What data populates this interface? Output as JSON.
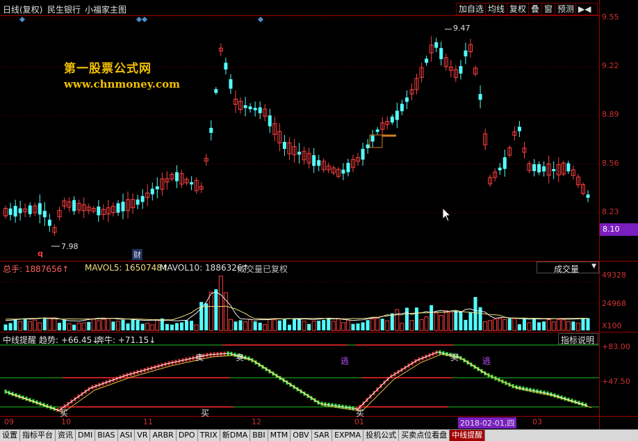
{
  "title_bar": {
    "mode": "日线(复权)",
    "stock": "民生银行",
    "template": "小福家主图",
    "buttons": [
      "加自选",
      "均线",
      "复权",
      "叠",
      "窗",
      "预测"
    ],
    "right_glyph": "▶◀"
  },
  "watermark": {
    "line1": "第一股票公式网",
    "line2": "www.chnmoney.com"
  },
  "price_axis": {
    "ticks": [
      "9.55",
      "9.22",
      "8.89",
      "8.56",
      "8.23"
    ],
    "current": "8.10"
  },
  "price_annotations": {
    "high": "9.47",
    "low": "7.98",
    "marker_q": "q",
    "marker_cai": "财"
  },
  "volume_pane": {
    "label_total": "总手: 1887656↑",
    "label_mavol5": "MAVOL5: 1650748↑",
    "label_mavol10": "MAVOL10: 1886326↑",
    "label_note": "成交量已复权",
    "selector": "成交量",
    "axis_ticks": [
      "49328",
      "24968"
    ],
    "axis_unit": "X100"
  },
  "indicator_pane": {
    "name": "中线提醒",
    "trend": "趋势: +66.45↓",
    "bull": "奔牛: +71.15↓",
    "help_button": "指标说明",
    "axis_ticks": [
      "+83.00",
      "+47.50"
    ],
    "signals_sell": [
      "卖",
      "卖"
    ],
    "signal_escape": [
      "逃",
      "逃"
    ],
    "signals_buy": [
      "买",
      "买",
      "买",
      "买"
    ]
  },
  "time_axis": {
    "labels": [
      "09",
      "10",
      "11",
      "12",
      "01",
      "03"
    ],
    "cursor_date": "2018-02-01,四"
  },
  "tabs": [
    "设置",
    "指标平台",
    "资讯",
    "DMI",
    "BIAS",
    "ASI",
    "VR",
    "ARBR",
    "DPO",
    "TRIX",
    "新DMA",
    "BBI",
    "MTM",
    "OBV",
    "SAR",
    "EXPMA",
    "投机公式",
    "买卖点位看盘",
    "中线提醒"
  ],
  "active_tab": "中线提醒",
  "colors": {
    "up": "#ff4040",
    "down": "#54ffff",
    "frame": "#a00000",
    "highlight": "#7a1fbf",
    "watermark": "#f0c000"
  }
}
